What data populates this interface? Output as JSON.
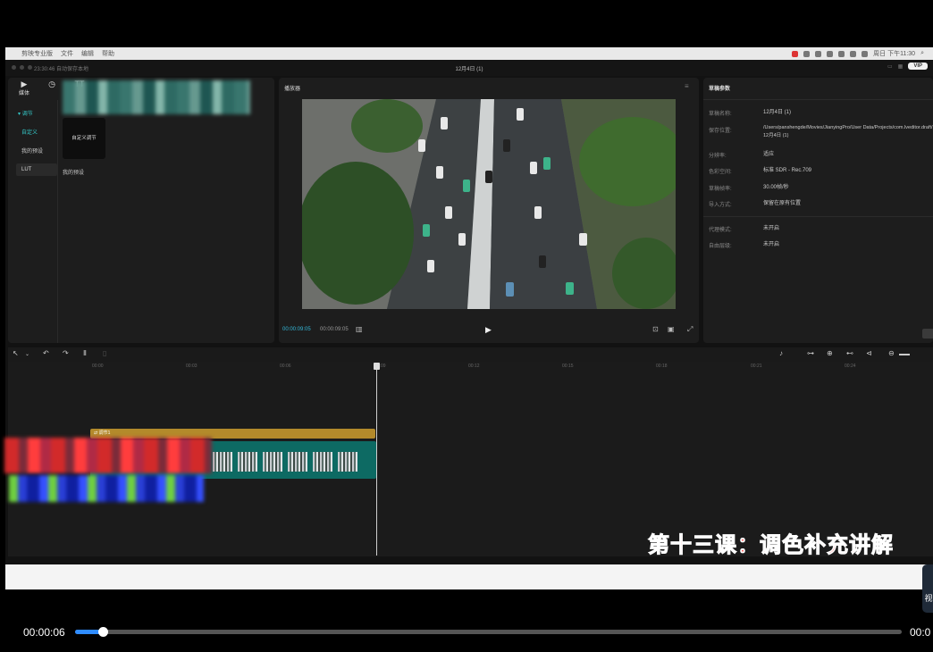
{
  "menubar": {
    "app_name": "剪映专业版",
    "menus": [
      "文件",
      "编辑",
      "帮助"
    ],
    "clock": "周日 下午11:30"
  },
  "titlebar": {
    "autosave": "23:30:46 自动保存本地",
    "project_title": "12月4日 (1)",
    "vip_label": "VIP"
  },
  "left_panel": {
    "tools": [
      {
        "icon": "media-icon",
        "label": "媒体"
      },
      {
        "icon": "audio-icon",
        "label": ""
      },
      {
        "icon": "text-icon",
        "label": "TT"
      }
    ],
    "categories": [
      "调节",
      "自定义",
      "我的预设",
      "LUT"
    ],
    "preset_card": "自定义调节",
    "my_presets": "我的预设"
  },
  "player": {
    "title": "播放器",
    "current_time": "00:00:09:05",
    "total_time": "00:00:09:05"
  },
  "draft": {
    "title": "草稿参数",
    "fields": [
      {
        "label": "草稿名称:",
        "value": "12月4日 (1)"
      },
      {
        "label": "保存位置:",
        "value": "/Users/panshengde/Movies/JianyingPro/User Data/Projects/com.lveditor.draft/12月4日 (1)"
      },
      {
        "label": "分辨率:",
        "value": "适应"
      },
      {
        "label": "色彩空间:",
        "value": "标准 SDR - Rec.709"
      },
      {
        "label": "草稿帧率:",
        "value": "30.00帧/秒"
      },
      {
        "label": "导入方式:",
        "value": "保留在原有位置"
      },
      {
        "label": "代理模式:",
        "value": "未开启"
      },
      {
        "label": "自由层级:",
        "value": "未开启"
      }
    ]
  },
  "timeline": {
    "ticks": [
      "00:00",
      "00:03",
      "00:06",
      "00:09",
      "00:12",
      "00:15",
      "00:18",
      "00:21",
      "00:24"
    ],
    "adjust_clip_label": "调节1"
  },
  "caption": "第十三课：调色补充讲解",
  "side_tab": "视",
  "video_player": {
    "current": "00:00:06",
    "total": "00:0",
    "progress": 0.034
  }
}
